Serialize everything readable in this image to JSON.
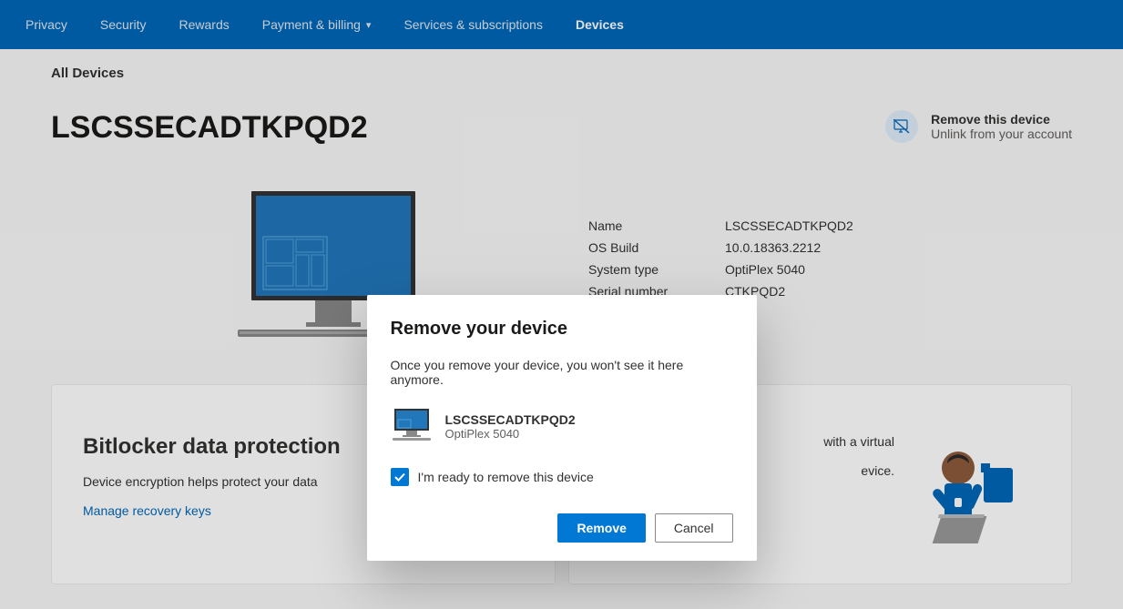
{
  "nav": {
    "items": [
      {
        "label": "Privacy"
      },
      {
        "label": "Security"
      },
      {
        "label": "Rewards"
      },
      {
        "label": "Payment & billing",
        "hasDropdown": true
      },
      {
        "label": "Services & subscriptions"
      },
      {
        "label": "Devices",
        "active": true
      }
    ]
  },
  "breadcrumb": "All Devices",
  "deviceTitle": "LSCSSECADTKPQD2",
  "removeDevice": {
    "title": "Remove this device",
    "subtitle": "Unlink from your account"
  },
  "deviceInfo": {
    "rows": [
      {
        "label": "Name",
        "value": "LSCSSECADTKPQD2"
      },
      {
        "label": "OS Build",
        "value": "10.0.18363.2212"
      },
      {
        "label": "System type",
        "value": "OptiPlex 5040"
      },
      {
        "label": "Serial number",
        "value": "CTKPQD2"
      }
    ]
  },
  "cards": {
    "bitlocker": {
      "title": "Bitlocker data protection",
      "desc": "Device encryption helps protect your data",
      "link": "Manage recovery keys"
    },
    "support": {
      "partialText1": "with a virtual",
      "partialText2": "evice."
    }
  },
  "modal": {
    "title": "Remove your device",
    "desc": "Once you remove your device, you won't see it here anymore.",
    "deviceName": "LSCSSECADTKPQD2",
    "deviceType": "OptiPlex 5040",
    "checkboxLabel": "I'm ready to remove this device",
    "removeBtn": "Remove",
    "cancelBtn": "Cancel"
  }
}
